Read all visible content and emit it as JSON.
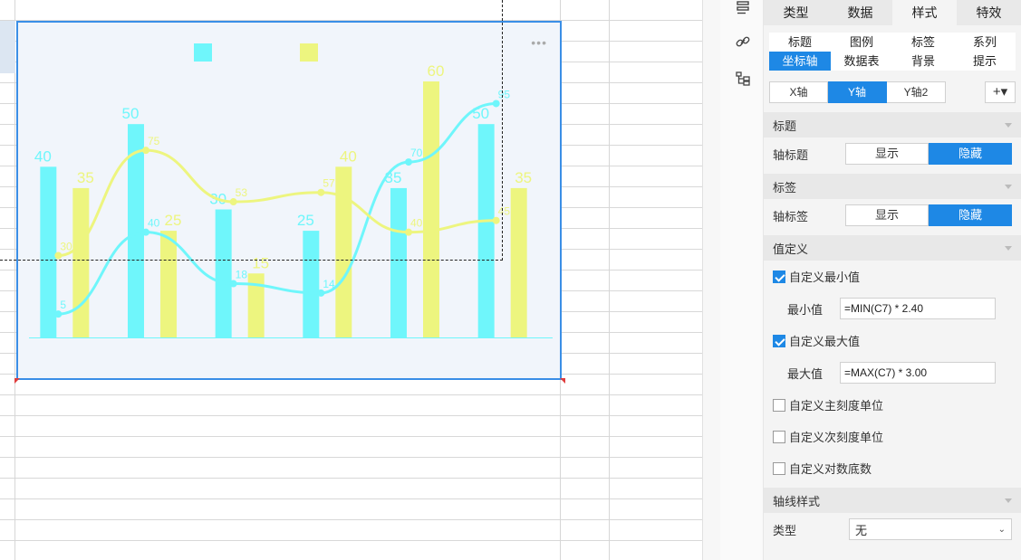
{
  "panel": {
    "tabs": [
      {
        "label": "类型",
        "active": false
      },
      {
        "label": "数据",
        "active": false
      },
      {
        "label": "样式",
        "active": true
      },
      {
        "label": "特效",
        "active": false
      }
    ],
    "subtabs": [
      {
        "label": "标题"
      },
      {
        "label": "图例"
      },
      {
        "label": "标签"
      },
      {
        "label": "系列"
      },
      {
        "label": "坐标轴"
      },
      {
        "label": "数据表"
      },
      {
        "label": "背景"
      },
      {
        "label": "提示"
      }
    ],
    "axis_buttons": [
      {
        "label": "X轴"
      },
      {
        "label": "Y轴"
      },
      {
        "label": "Y轴2"
      }
    ],
    "axis_add": "+▾",
    "sections": {
      "title": "标题",
      "label": "标签",
      "value_def": "值定义",
      "axis_style": "轴线样式"
    },
    "axis_title": {
      "label": "轴标题",
      "show": "显示",
      "hide": "隐藏"
    },
    "axis_label": {
      "label": "轴标签",
      "show": "显示",
      "hide": "隐藏"
    },
    "checks": {
      "custom_min": {
        "label": "自定义最小值",
        "checked": true
      },
      "custom_max": {
        "label": "自定义最大值",
        "checked": true
      },
      "custom_major": {
        "label": "自定义主刻度单位",
        "checked": false
      },
      "custom_minor": {
        "label": "自定义次刻度单位",
        "checked": false
      },
      "custom_log": {
        "label": "自定义对数底数",
        "checked": false
      }
    },
    "min_value": {
      "label": "最小值",
      "value": "=MIN(C7) * 2.40"
    },
    "max_value": {
      "label": "最大值",
      "value": "=MAX(C7) * 3.00"
    },
    "type_row": {
      "label": "类型",
      "value": "无"
    }
  },
  "chart_data": {
    "type": "bar",
    "more_label": "•••",
    "categories": [
      "",
      "",
      "",
      "",
      "",
      ""
    ],
    "series": [
      {
        "kind": "bar",
        "color": "#6ff6fb",
        "values": [
          40,
          50,
          30,
          25,
          35,
          50
        ]
      },
      {
        "kind": "bar",
        "color": "#edf57f",
        "values": [
          35,
          25,
          15,
          40,
          60,
          35
        ]
      },
      {
        "kind": "line",
        "color": "#6ff6fb",
        "values": [
          5,
          40,
          18,
          14,
          70,
          95
        ]
      },
      {
        "kind": "line",
        "color": "#edf57f",
        "values": [
          30,
          75,
          53,
          57,
          40,
          45
        ]
      }
    ],
    "ylim": [
      0,
      60
    ],
    "line_ylim": [
      -5,
      118
    ],
    "legend": "top-center",
    "grid": false
  },
  "colors": {
    "accent": "#1e88e5",
    "chart_border": "#3a8ee6",
    "chart_bg": "#f1f5fb"
  },
  "icons": {
    "rail": [
      "format-icon",
      "link-icon",
      "tree-icon"
    ]
  }
}
